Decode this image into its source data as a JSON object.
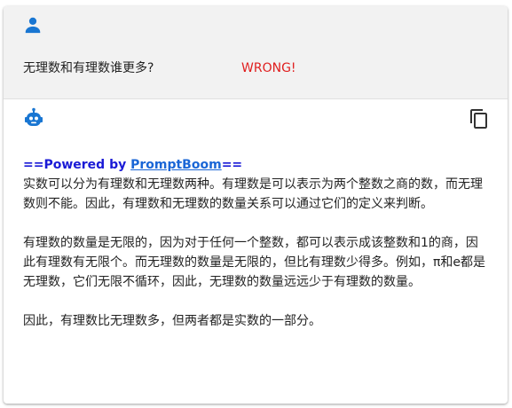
{
  "user_message": {
    "icon": "person-icon",
    "text": "无理数和有理数谁更多?",
    "flag": "WRONG!",
    "flag_color": "#e02020"
  },
  "assistant_message": {
    "icon": "robot-icon",
    "copy_icon": "copy-icon",
    "powered_prefix": "==Powered by ",
    "powered_link": "PromptBoom",
    "powered_suffix": "==",
    "paragraphs": [
      "实数可以分为有理数和无理数两种。有理数是可以表示为两个整数之商的数，而无理数则不能。因此，有理数和无理数的数量关系可以通过它们的定义来判断。",
      "有理数的数量是无限的，因为对于任何一个整数，都可以表示成该整数和1的商，因此有理数有无限个。而无理数的数量是无限的，但比有理数少得多。例如，π和e都是无理数，它们无限不循环，因此，无理数的数量远远少于有理数的数量。",
      "因此，有理数比无理数多，但两者都是实数的一部分。"
    ]
  },
  "colors": {
    "accent": "#1976d2",
    "user_bg": "#f2f2f2",
    "powered_text": "#1a1ad6",
    "link": "#1a66d6"
  }
}
